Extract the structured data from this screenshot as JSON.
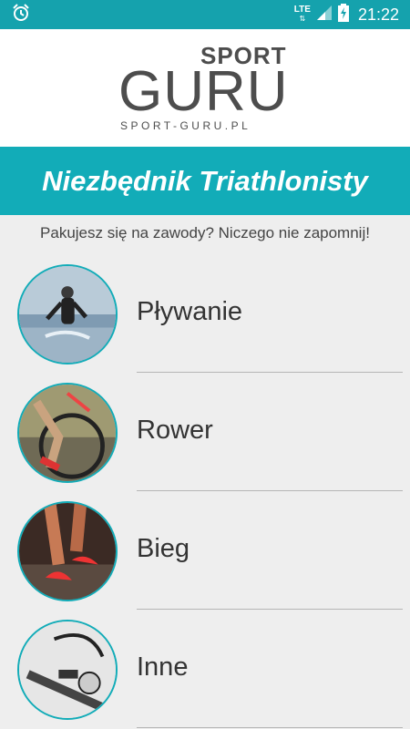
{
  "status_bar": {
    "network": "LTE",
    "network_sub": "⇅",
    "time": "21:22"
  },
  "logo": {
    "sport": "SPORT",
    "guru": "GURU",
    "url": "SPORT-GURU.PL"
  },
  "header": {
    "title": "Niezbędnik Triathlonisty"
  },
  "subtitle": "Pakujesz się na zawody? Niczego nie zapomnij!",
  "items": [
    {
      "label": "Pływanie"
    },
    {
      "label": "Rower"
    },
    {
      "label": "Bieg"
    },
    {
      "label": "Inne"
    }
  ],
  "colors": {
    "accent": "#12acb8",
    "status_bar": "#15a2ad",
    "background": "#eeeeee"
  }
}
